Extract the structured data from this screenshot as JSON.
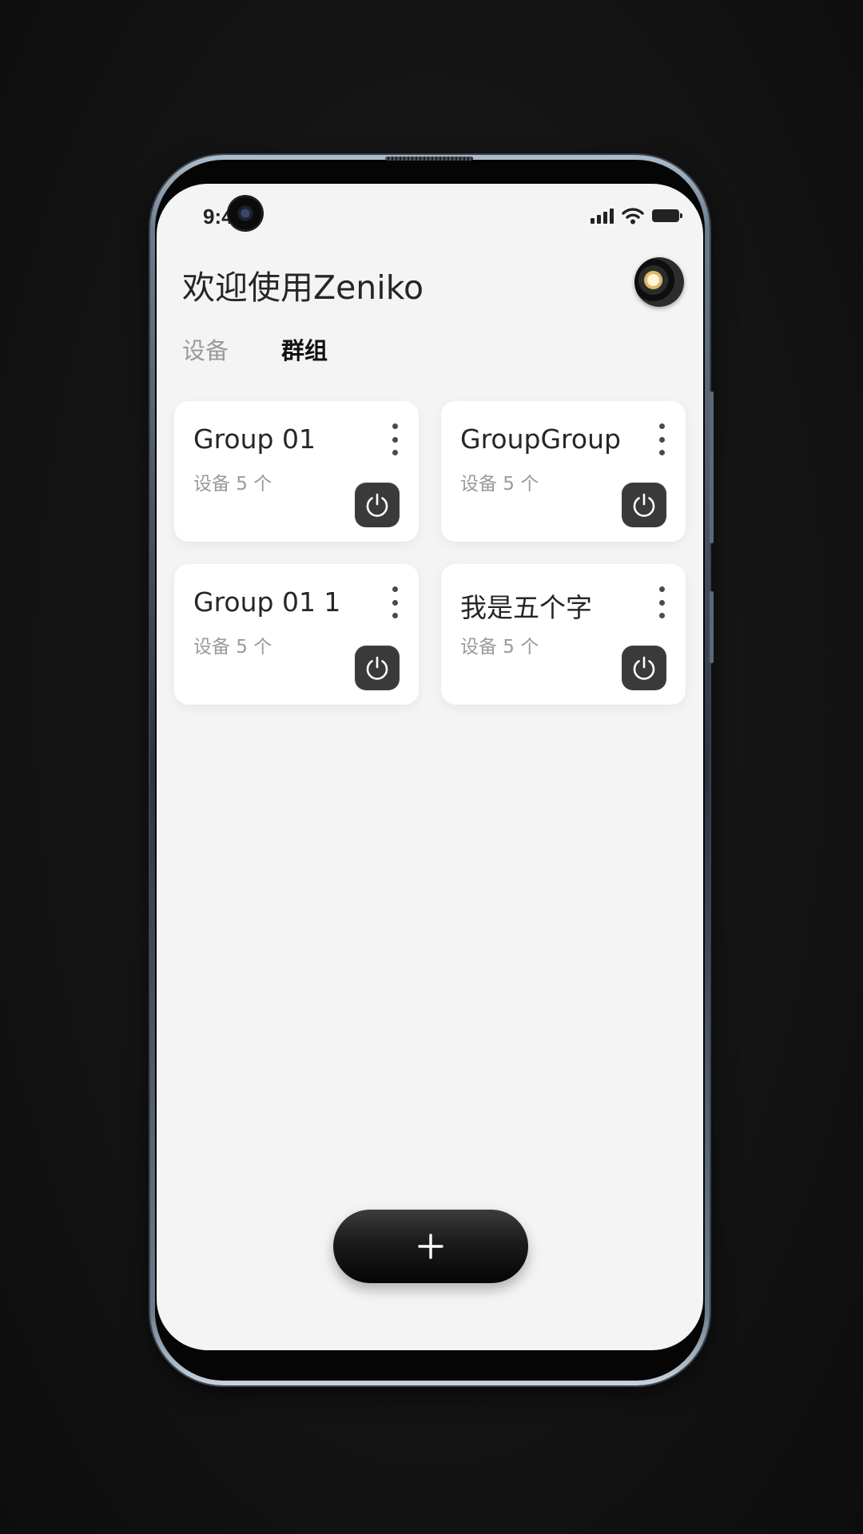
{
  "status_bar": {
    "time": "9:4"
  },
  "header": {
    "title": "欢迎使用Zeniko"
  },
  "tabs": [
    {
      "label": "设备",
      "active": false
    },
    {
      "label": "群组",
      "active": true
    }
  ],
  "groups": [
    {
      "name": "Group 01",
      "count_label": "设备 5 个"
    },
    {
      "name": "GroupGroup",
      "count_label": "设备 5 个"
    },
    {
      "name": "Group 01 1",
      "count_label": "设备 5 个"
    },
    {
      "name": "我是五个字",
      "count_label": "设备 5 个"
    }
  ],
  "icons": {
    "more": "more-vertical-icon",
    "power": "power-icon",
    "add": "plus-icon"
  },
  "colors": {
    "screen_bg": "#f4f4f4",
    "card_bg": "#ffffff",
    "power_btn_bg": "#3a3a3a",
    "active_tab": "#111111",
    "inactive_tab": "#9a9a9a"
  }
}
